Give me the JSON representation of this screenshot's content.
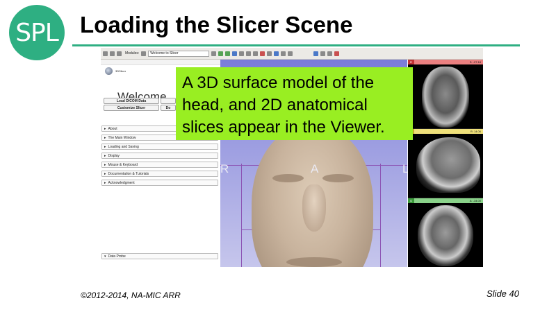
{
  "slide": {
    "logo_text": "SPL",
    "title": "Loading the Slicer Scene",
    "copyright": "©2012-2014, NA-MIC ARR",
    "slide_number": "Slide 40",
    "accent_color": "#2eaf82"
  },
  "toolbar": {
    "modules_label": "Modules:",
    "module_selected": "Welcome to Slicer"
  },
  "panel": {
    "brand": "3DSlicer",
    "welcome": "Welcome",
    "load_dicom": "Load DICOM Data",
    "customize": "Customize Slicer",
    "download_partial": "Do",
    "sections": [
      "About",
      "The Main Window",
      "Loading and Saving",
      "Display",
      "Mouse & Keyboard",
      "Documentation & Tutorials",
      "Acknowledgment"
    ],
    "data_probe": "Data Probe",
    "probe_lines": [
      "L",
      "B"
    ]
  },
  "view3d": {
    "left": "R",
    "anterior": "A",
    "right": "L"
  },
  "slices": [
    {
      "tag": "R",
      "color": "red",
      "value": "S: -27.18"
    },
    {
      "tag": "Y",
      "color": "yellow",
      "value": "R: 14.06"
    },
    {
      "tag": "G",
      "color": "green",
      "value": "A: -34.00"
    }
  ],
  "callout": {
    "text": "A 3D surface model of the head, and 2D anatomical slices appear in the Viewer.",
    "color": "#99ee22"
  }
}
